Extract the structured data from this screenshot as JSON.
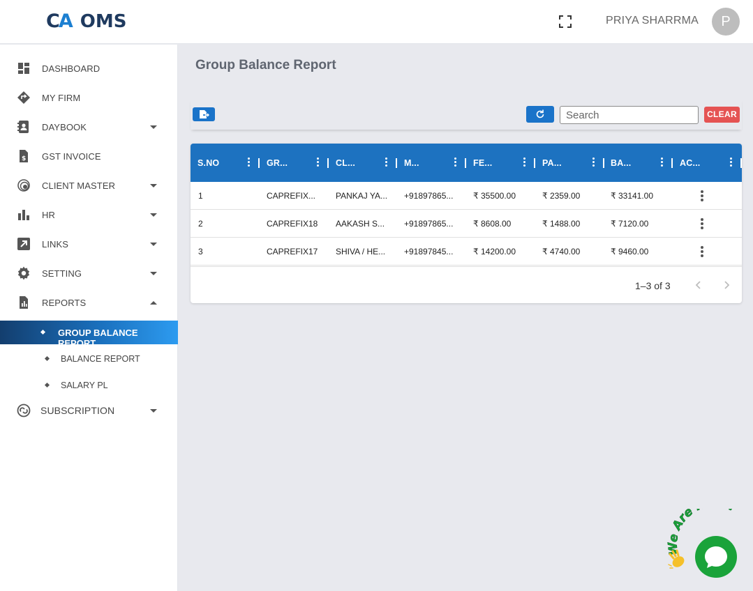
{
  "app": {
    "logo_mark_c": "C",
    "logo_mark_a": "A",
    "logo_text": "OMS"
  },
  "header": {
    "user_name": "PRIYA SHARRMA",
    "avatar_initial": "P"
  },
  "sidebar": {
    "items": [
      {
        "label": "DASHBOARD",
        "icon": "dashboard-icon",
        "has_caret": false
      },
      {
        "label": "MY FIRM",
        "icon": "firm-icon",
        "has_caret": false
      },
      {
        "label": "DAYBOOK",
        "icon": "contact-book-icon",
        "has_caret": true
      },
      {
        "label": "GST INVOICE",
        "icon": "invoice-icon",
        "has_caret": false
      },
      {
        "label": "CLIENT MASTER",
        "icon": "client-icon",
        "has_caret": true
      },
      {
        "label": "HR",
        "icon": "bar-chart-icon",
        "has_caret": true
      },
      {
        "label": "LINKS",
        "icon": "external-link-icon",
        "has_caret": true
      },
      {
        "label": "SETTING",
        "icon": "gear-icon",
        "has_caret": true
      },
      {
        "label": "REPORTS",
        "icon": "report-icon",
        "has_caret": true,
        "expanded": true
      }
    ],
    "report_subitems": [
      {
        "label": "GROUP BALANCE REPORT",
        "active": true
      },
      {
        "label": "BALANCE REPORT",
        "active": false
      },
      {
        "label": "SALARY PL",
        "active": false
      }
    ],
    "subscription": {
      "label": "SUBSCRIPTION",
      "icon": "subscription-icon"
    }
  },
  "page": {
    "title": "Group Balance Report"
  },
  "toolbar": {
    "search_placeholder": "Search",
    "clear_label": "CLEAR"
  },
  "table": {
    "columns": [
      "S.NO",
      "GR...",
      "CL...",
      "M...",
      "FE...",
      "PA...",
      "BA...",
      "AC..."
    ],
    "rows": [
      {
        "sno": "1",
        "group": "CAPREFIX...",
        "client": "PANKAJ YA...",
        "mobile": "+91897865...",
        "fees": "₹ 35500.00",
        "paid": "₹ 2359.00",
        "balance": "₹ 33141.00"
      },
      {
        "sno": "2",
        "group": "CAPREFIX18",
        "client": "AAKASH S...",
        "mobile": "+91897865...",
        "fees": "₹ 8608.00",
        "paid": "₹ 1488.00",
        "balance": "₹ 7120.00"
      },
      {
        "sno": "3",
        "group": "CAPREFIX17",
        "client": "SHIVA / HE...",
        "mobile": "+91897845...",
        "fees": "₹ 14200.00",
        "paid": "₹ 4740.00",
        "balance": "₹ 9460.00"
      }
    ],
    "pagination": "1–3 of 3"
  },
  "chat": {
    "badge_text": "We Are Here!",
    "icon": "chat-bubble-icon"
  },
  "colors": {
    "accent": "#1d72c0",
    "danger": "#e55353",
    "chat": "#1aa33a"
  }
}
